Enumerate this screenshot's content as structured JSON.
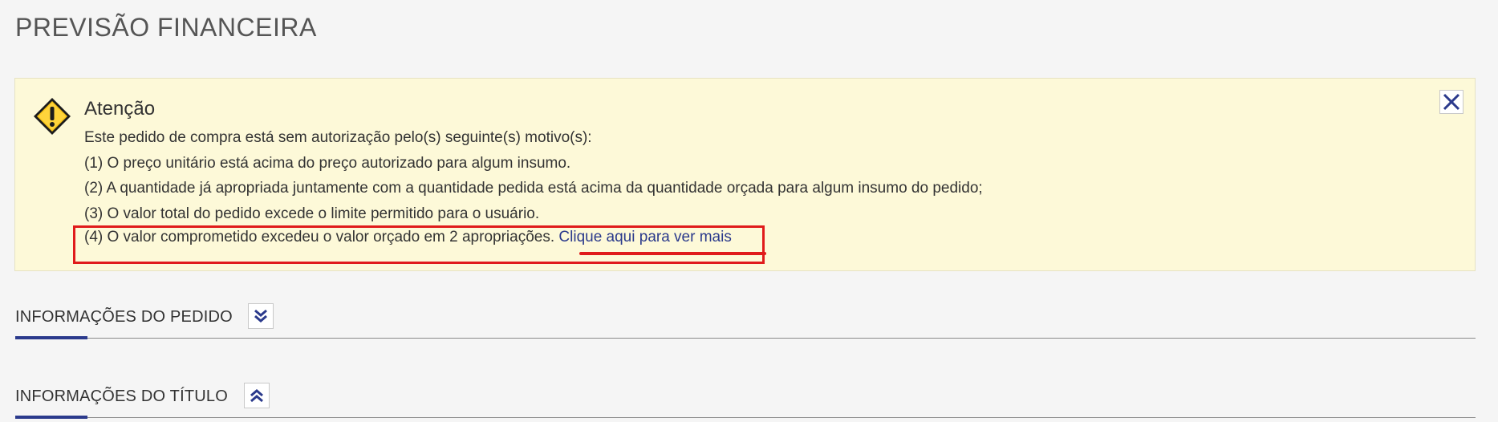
{
  "page": {
    "title": "PREVISÃO FINANCEIRA"
  },
  "alert": {
    "icon": "warning-icon",
    "close_icon": "close-icon",
    "title": "Atenção",
    "intro": "Este pedido de compra está sem autorização pelo(s) seguinte(s) motivo(s):",
    "reasons": [
      "(1) O preço unitário está acima do preço autorizado para algum insumo.",
      "(2) A quantidade já apropriada juntamente com a quantidade pedida está acima da quantidade orçada para algum insumo do pedido;",
      "(3) O valor total do pedido excede o limite permitido para o usuário.",
      "(4) O valor comprometido excedeu o valor orçado em 2 apropriações."
    ],
    "more_link": "Clique aqui para ver mais",
    "highlight_color": "#e01b1b"
  },
  "sections": [
    {
      "title": "INFORMAÇÕES DO PEDIDO",
      "toggle_icon": "chevron-double-down-icon",
      "expanded": false
    },
    {
      "title": "INFORMAÇÕES DO TÍTULO",
      "toggle_icon": "chevron-double-up-icon",
      "expanded": true
    }
  ],
  "colors": {
    "accent": "#2b3a8c",
    "alert_background": "#fdf9d8",
    "background": "#f5f5f5"
  }
}
